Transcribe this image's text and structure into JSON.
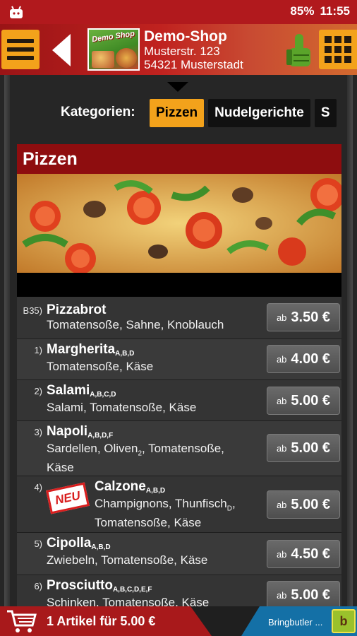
{
  "status": {
    "battery": "85%",
    "time": "11:55"
  },
  "shop": {
    "name": "Demo-Shop",
    "street": "Musterstr. 123",
    "city": "54321 Musterstadt",
    "logo_text": "Demo Shop"
  },
  "categories": {
    "label": "Kategorien:",
    "tabs": [
      {
        "label": "Pizzen",
        "active": true
      },
      {
        "label": "Nudelgerichte",
        "active": false
      },
      {
        "label": "S",
        "active": false
      }
    ]
  },
  "section": {
    "title": "Pizzen"
  },
  "items": [
    {
      "num": "B35)",
      "name": "Pizzabrot",
      "allergens": "",
      "desc": "Tomatensoße, Sahne, Knoblauch",
      "ab": "ab",
      "price": "3.50 €"
    },
    {
      "num": "1)",
      "name": "Margherita",
      "allergens": "A,B,D",
      "desc": "Tomatensoße, Käse",
      "ab": "ab",
      "price": "4.00 €"
    },
    {
      "num": "2)",
      "name": "Salami",
      "allergens": "A,B,C,D",
      "desc": "Salami, Tomatensoße, Käse",
      "ab": "ab",
      "price": "5.00 €"
    },
    {
      "num": "3)",
      "name": "Napoli",
      "allergens": "A,B,D,F",
      "desc_1": "Sardellen, Oliven",
      "desc_sub": "2",
      "desc_2": ", Tomatensoße,",
      "desc_3": "Käse",
      "ab": "ab",
      "price": "5.00 €"
    },
    {
      "num": "4)",
      "badge": "NEU",
      "name": "Calzone",
      "allergens": "A,B,D",
      "desc_1": "Champignons, Thunfisch",
      "desc_sub": "D",
      "desc_2": ",",
      "desc_3": "Tomatensoße, Käse",
      "ab": "ab",
      "price": "5.00 €"
    },
    {
      "num": "5)",
      "name": "Cipolla",
      "allergens": "A,B,D",
      "desc": "Zwiebeln, Tomatensoße, Käse",
      "ab": "ab",
      "price": "4.50 €"
    },
    {
      "num": "6)",
      "name": "Prosciutto",
      "allergens": "A,B,C,D,E,F",
      "desc": "Schinken, Tomatensoße, Käse",
      "ab": "ab",
      "price": "5.00 €"
    }
  ],
  "cart": {
    "text": "1 Artikel für 5.00 €"
  },
  "footer": {
    "brand": "Bringbutler ..."
  },
  "colors": {
    "accent": "#f3a21b",
    "header_red": "#b1191d",
    "section_red": "#8e0d0f",
    "bringbutler_blue": "#1470a6"
  }
}
